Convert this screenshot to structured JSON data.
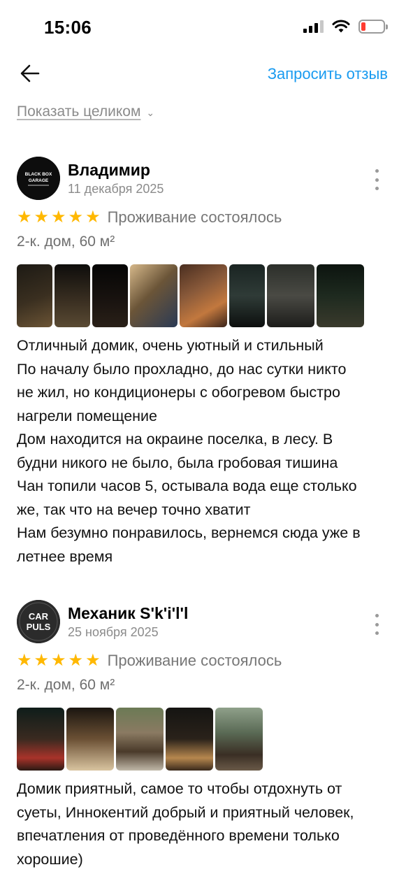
{
  "status_bar": {
    "time": "15:06",
    "icons": [
      "signal-icon",
      "wifi-icon",
      "battery-icon"
    ],
    "battery_color": "#ff3b30"
  },
  "nav": {
    "back_icon": "arrow-left-icon",
    "request_review_label": "Запросить отзыв",
    "accent_color": "#1a9bf0"
  },
  "show_all": {
    "label": "Показать целиком",
    "chevron": "⌄"
  },
  "reviews": [
    {
      "author": "Владимир",
      "date": "11 декабря 2025",
      "avatar_icon": "black-box-garage-logo",
      "avatar_text": [
        "BLACK BOX",
        "GARAGE"
      ],
      "rating": 5,
      "stars": [
        "★",
        "★",
        "★",
        "★",
        "★"
      ],
      "stay_status": "Проживание состоялось",
      "property": "2-к. дом, 60 м²",
      "photo_count": 8,
      "text_lines": [
        "Отличный домик, очень уютный и стильный",
        "По началу было прохладно, до нас сутки никто",
        "не жил, но кондиционеры с обогревом быстро",
        "нагрели помещение",
        "Дом находится на окраине поселка, в лесу. В",
        "будни никого не было, была гробовая тишина",
        "Чан топили часов 5, остывала вода еще столько",
        "же, так что на вечер точно хватит",
        "Нам безумно понравилось, вернемся сюда уже в",
        "летнее время"
      ]
    },
    {
      "author": "Механик S'k'i'l'l",
      "date": "25 ноября 2025",
      "avatar_icon": "car-puls-logo",
      "avatar_text": [
        "CAR",
        "PULS"
      ],
      "rating": 5,
      "stars": [
        "★",
        "★",
        "★",
        "★",
        "★"
      ],
      "stay_status": "Проживание состоялось",
      "property": "2-к. дом, 60 м²",
      "photo_count": 5,
      "text_lines": [
        "Домик приятный, самое то чтобы отдохнуть от",
        "суеты, Иннокентий добрый и приятный человек,",
        "впечатления от проведённого времени только",
        "хорошие)"
      ]
    }
  ],
  "star_color": "#ffb800"
}
